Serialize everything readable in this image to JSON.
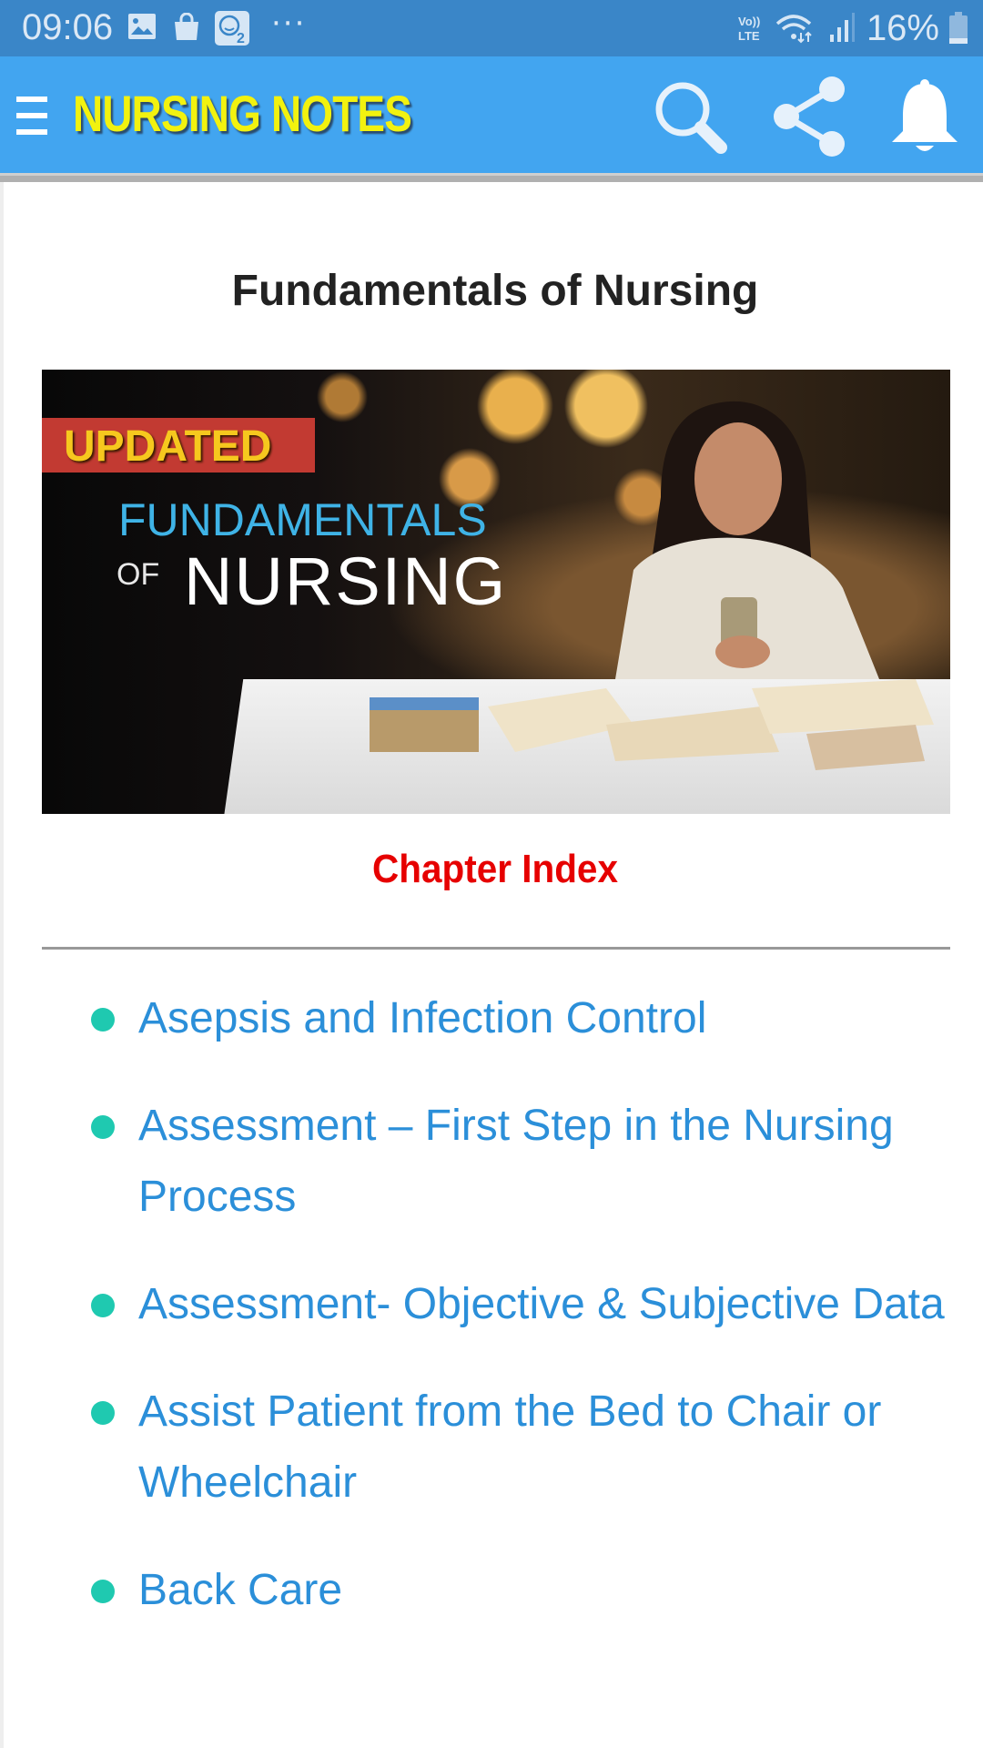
{
  "status_bar": {
    "time": "09:06",
    "left_icons": [
      "gallery-icon",
      "shopping-bag-icon",
      "talking-cat-app-icon"
    ],
    "more": "···",
    "network": "VoLTE",
    "battery_percent": "16%"
  },
  "app_bar": {
    "title": "NURSING NOTES",
    "actions": [
      "search-icon",
      "share-icon",
      "notification-bell-icon"
    ]
  },
  "page": {
    "title": "Fundamentals of Nursing",
    "banner": {
      "badge": "UPDATED",
      "line1": "FUNDAMENTALS",
      "line2_small": "OF",
      "line2": "NURSING"
    },
    "section_heading": "Chapter Index",
    "chapters": [
      {
        "label": "Asepsis and Infection Control"
      },
      {
        "label": "Assessment – First Step in the Nursing Process"
      },
      {
        "label": "Assessment- Objective & Subjective Data"
      },
      {
        "label": "Assist Patient from the Bed to Chair or Wheelchair"
      },
      {
        "label": "Back Care"
      }
    ]
  },
  "colors": {
    "status_bar": "#3a86c8",
    "app_bar": "#42a5f0",
    "brand_text": "#f2f20f",
    "heading_red": "#e60000",
    "link_blue": "#2b8fd9",
    "bullet_teal": "#1fc9b0"
  }
}
